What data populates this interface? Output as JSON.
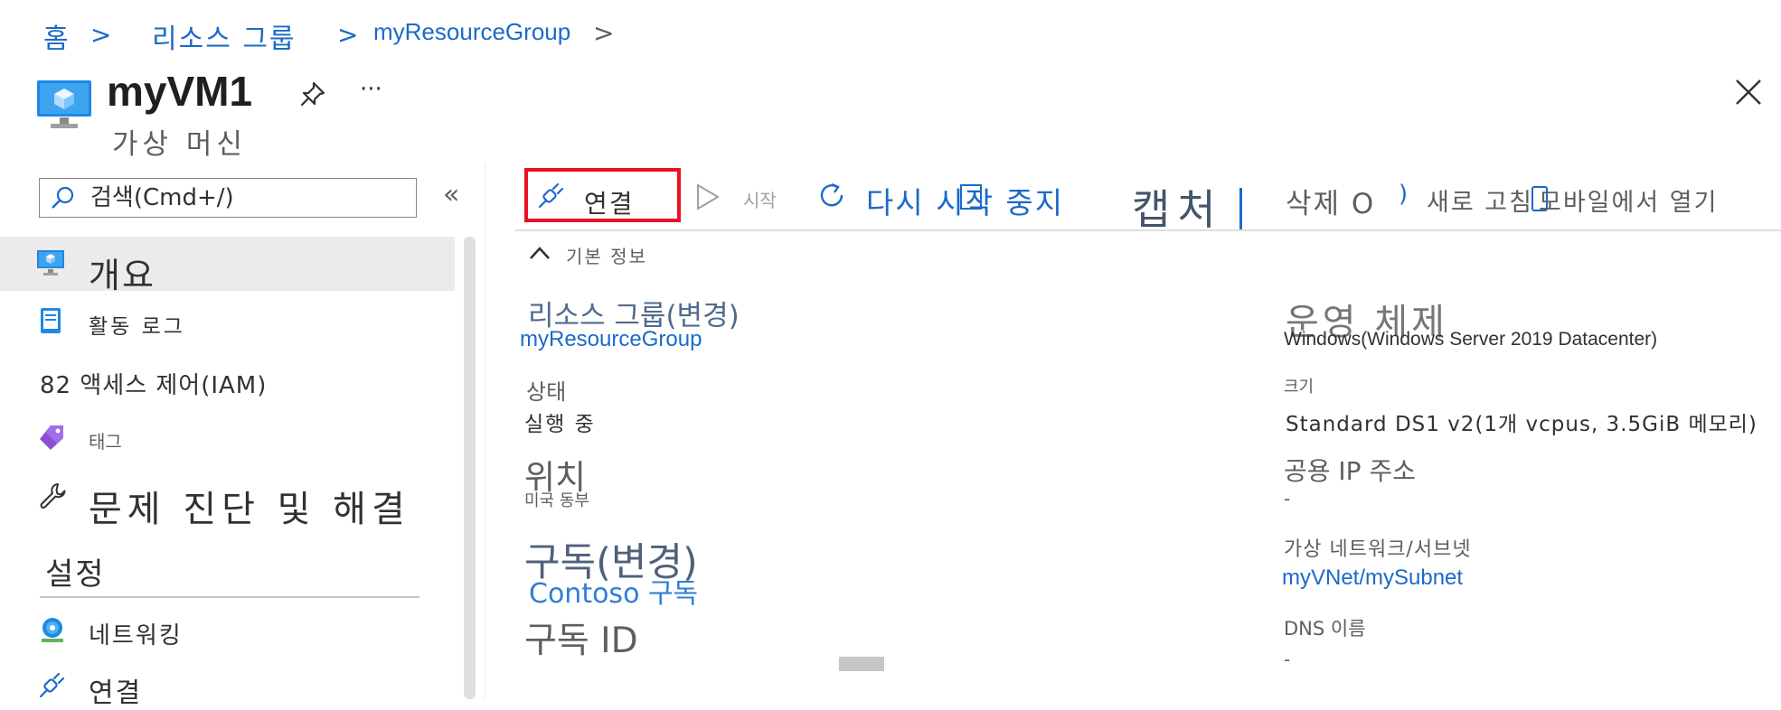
{
  "breadcrumb": {
    "home": "홈",
    "resource_groups": "리소스 그룹",
    "resource_group": "myResourceGroup",
    "sep": ">"
  },
  "header": {
    "title": "myVM1",
    "subtitle": "가상 머신",
    "more": "···"
  },
  "search": {
    "placeholder": "검색(Cmd+/)",
    "collapse": "«"
  },
  "sidebar": {
    "items": [
      {
        "label": "개요"
      },
      {
        "label": "활동 로그"
      },
      {
        "label": "82 액세스 제어(IAM)"
      },
      {
        "label": "태그"
      },
      {
        "label": "문제 진단 및 해결"
      }
    ],
    "section_settings": "설정",
    "settings_items": [
      {
        "label": "네트워킹"
      },
      {
        "label": "연결"
      }
    ]
  },
  "toolbar": {
    "connect": "연결",
    "start": "시작",
    "restart_stop": "다시 시작 중지",
    "capture": "캡처",
    "delete": "삭제 O",
    "refresh": "새로 고침",
    "open_mobile": "모바일에서 열기"
  },
  "essentials": {
    "header": "기본 정보",
    "left": {
      "resource_group_label": "리소스 그룹(변경)",
      "resource_group_value": "myResourceGroup",
      "status_label": "상태",
      "status_value": "실행 중",
      "location_label": "위치",
      "location_value": "미국 동부",
      "subscription_label": "구독(변경)",
      "subscription_value": "Contoso 구독",
      "subscription_id_label": "구독 ID"
    },
    "right": {
      "os_label": "운영 체제",
      "os_value": "Windows(Windows Server 2019 Datacenter)",
      "size_label": "크기",
      "size_value": "Standard DS1 v2(1개 vcpus, 3.5GiB 메모리)",
      "public_ip_label": "공용 IP 주소",
      "public_ip_value": "-",
      "vnet_label": "가상 네트워크/서브넷",
      "vnet_value": "myVNet/mySubnet",
      "dns_label": "DNS 이름",
      "dns_value": "-"
    }
  },
  "colors": {
    "accent": "#1b6ac9",
    "highlight_box": "#e81123",
    "selected_nav": "#edebe9"
  }
}
